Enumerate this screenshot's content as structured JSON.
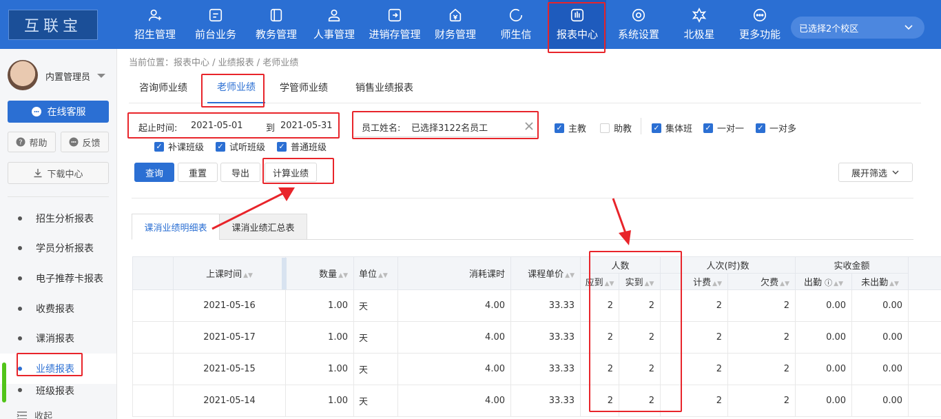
{
  "logo": "互联宝",
  "nav": [
    {
      "label": "招生管理",
      "icon": "user-add-icon"
    },
    {
      "label": "前台业务",
      "icon": "monitor-icon"
    },
    {
      "label": "教务管理",
      "icon": "book-icon"
    },
    {
      "label": "人事管理",
      "icon": "person-icon"
    },
    {
      "label": "进销存管理",
      "icon": "inventory-icon"
    },
    {
      "label": "财务管理",
      "icon": "money-bag-icon"
    },
    {
      "label": "师生信",
      "icon": "chat-icon"
    },
    {
      "label": "报表中心",
      "icon": "report-icon"
    },
    {
      "label": "系统设置",
      "icon": "settings-icon"
    },
    {
      "label": "北极星",
      "icon": "star-icon"
    },
    {
      "label": "更多功能",
      "icon": "more-icon"
    }
  ],
  "campus": {
    "label": "已选择2个校区"
  },
  "sidebar": {
    "admin_name": "内置管理员",
    "online_service": "在线客服",
    "help": "帮助",
    "feedback": "反馈",
    "download_center": "下载中心",
    "menu": [
      "招生分析报表",
      "学员分析报表",
      "电子推荐卡报表",
      "收费报表",
      "课消报表",
      "业绩报表",
      "班级报表"
    ],
    "collapse": "收起"
  },
  "breadcrumb": "当前位置：报表中心 / 业绩报表 / 老师业绩",
  "tabs": [
    "咨询师业绩",
    "老师业绩",
    "学管师业绩",
    "销售业绩报表"
  ],
  "filters": {
    "date_label": "起止时间:",
    "date_start": "2021-05-01",
    "date_to": "到",
    "date_end": "2021-05-31",
    "employee_label": "员工姓名:",
    "employee_value": "已选择3122名员工",
    "checks": [
      {
        "label": "主教",
        "checked": true
      },
      {
        "label": "助教",
        "checked": false
      },
      {
        "label": "集体班",
        "checked": true
      },
      {
        "label": "一对一",
        "checked": true
      },
      {
        "label": "一对多",
        "checked": true
      },
      {
        "label": "补课班级",
        "checked": true
      },
      {
        "label": "试听班级",
        "checked": true
      },
      {
        "label": "普通班级",
        "checked": true
      }
    ]
  },
  "actions": {
    "query": "查询",
    "reset": "重置",
    "export": "导出",
    "calculate": "计算业绩",
    "expand": "展开筛选"
  },
  "subtabs": [
    "课消业绩明细表",
    "课消业绩汇总表"
  ],
  "table": {
    "headers": {
      "class_time": "上课时间",
      "quantity": "数量",
      "unit": "单位",
      "consumed_hours": "消耗课时",
      "unit_price": "课程单价",
      "people": "人数",
      "people_due": "应到",
      "people_actual": "实到",
      "person_times": "人次(时)数",
      "charged": "计费",
      "owed": "欠费",
      "received_amount": "实收金额",
      "attended": "出勤",
      "not_attended": "未出勤",
      "cut_off": "出"
    },
    "rows": [
      {
        "date": "2021-05-16",
        "qty": "1.00",
        "unit": "天",
        "hours": "4.00",
        "price": "33.33",
        "due": "2",
        "actual": "2",
        "charged": "2",
        "owed": "2",
        "attended": "0.00",
        "not_attended": "0.00"
      },
      {
        "date": "2021-05-17",
        "qty": "1.00",
        "unit": "天",
        "hours": "4.00",
        "price": "33.33",
        "due": "2",
        "actual": "2",
        "charged": "2",
        "owed": "2",
        "attended": "0.00",
        "not_attended": "0.00"
      },
      {
        "date": "2021-05-15",
        "qty": "1.00",
        "unit": "天",
        "hours": "4.00",
        "price": "33.33",
        "due": "2",
        "actual": "2",
        "charged": "2",
        "owed": "2",
        "attended": "0.00",
        "not_attended": "0.00"
      },
      {
        "date": "2021-05-14",
        "qty": "1.00",
        "unit": "天",
        "hours": "4.00",
        "price": "33.33",
        "due": "2",
        "actual": "2",
        "charged": "2",
        "owed": "2",
        "attended": "0.00",
        "not_attended": "0.00"
      }
    ]
  },
  "colors": {
    "primary": "#2b6fd3",
    "highlight": "#e8242a"
  }
}
